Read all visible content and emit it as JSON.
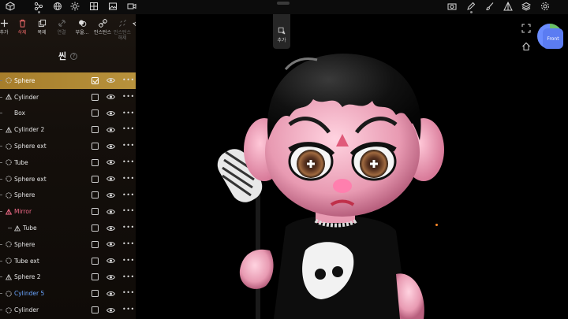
{
  "topbar": {
    "left_icons": [
      "cube-icon",
      "node-graph-icon",
      "globe-icon",
      "sun-icon",
      "grid-icon",
      "image-icon",
      "video-icon"
    ],
    "right_icons": [
      "camera-icon",
      "pen-icon",
      "brush-icon",
      "layers-triangle-icon",
      "stack-icon",
      "settings-icon"
    ]
  },
  "actions": [
    {
      "label": "추가",
      "icon": "plus-icon",
      "state": "normal"
    },
    {
      "label": "삭제",
      "icon": "trash-icon",
      "state": "danger"
    },
    {
      "label": "복제",
      "icon": "duplicate-icon",
      "state": "normal"
    },
    {
      "label": "연결",
      "icon": "link-icon",
      "state": "disabled"
    },
    {
      "label": "부울...",
      "icon": "boolean-icon",
      "state": "normal"
    },
    {
      "label": "인스턴스",
      "icon": "instance-icon",
      "state": "normal"
    },
    {
      "label": "인스턴스 해제",
      "icon": "unlink-icon",
      "state": "disabled"
    },
    {
      "label": "",
      "icon": "pin-icon",
      "state": "normal"
    }
  ],
  "scene": {
    "title": "씬",
    "help": "?"
  },
  "objects": [
    {
      "name": "Sphere",
      "icon": "sphere-icon",
      "checked": true,
      "selected": true
    },
    {
      "name": "Cylinder",
      "icon": "mesh-icon",
      "checked": false
    },
    {
      "name": "Box",
      "icon": "none",
      "checked": false
    },
    {
      "name": "Cylinder 2",
      "icon": "mesh-icon",
      "checked": false
    },
    {
      "name": "Sphere ext",
      "icon": "sphere-icon",
      "checked": false
    },
    {
      "name": "Tube",
      "icon": "sphere-icon",
      "checked": false
    },
    {
      "name": "Sphere ext",
      "icon": "sphere-icon",
      "checked": false
    },
    {
      "name": "Sphere",
      "icon": "sphere-icon",
      "checked": false
    },
    {
      "name": "Mirror",
      "icon": "mirror-icon",
      "checked": false,
      "kind": "mirror"
    },
    {
      "name": "Tube",
      "icon": "mesh-icon",
      "checked": false,
      "child": true
    },
    {
      "name": "Sphere",
      "icon": "sphere-icon",
      "checked": false
    },
    {
      "name": "Tube ext",
      "icon": "sphere-icon",
      "checked": false
    },
    {
      "name": "Sphere 2",
      "icon": "mesh-icon",
      "checked": false
    },
    {
      "name": "Cylinder 5",
      "icon": "sphere-icon",
      "checked": false,
      "kind": "linked"
    },
    {
      "name": "Cylinder",
      "icon": "sphere-icon",
      "checked": false
    }
  ],
  "viewport": {
    "add_label": "추가",
    "view_label": "Front",
    "icons": [
      "fullscreen-icon",
      "home-icon",
      "view-cube"
    ]
  },
  "colors": {
    "selected": "#b08634",
    "mirror": "#f06a88",
    "linked": "#6aa6ff",
    "danger": "#f06a6a",
    "cube_face": "#5b7cf2"
  }
}
